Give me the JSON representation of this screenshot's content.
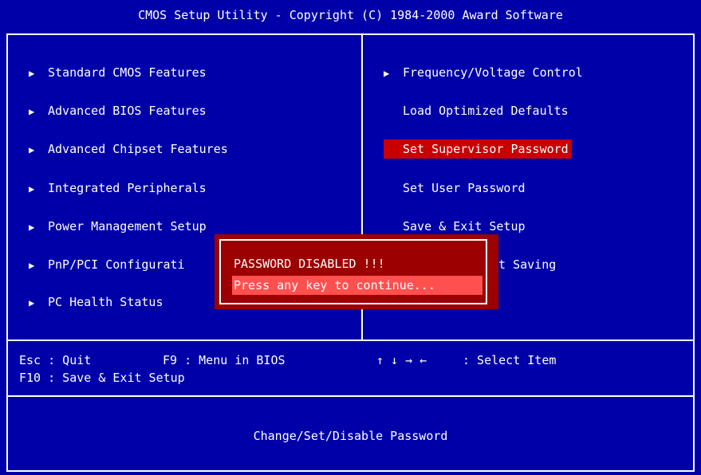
{
  "header": {
    "title": "CMOS Setup Utility - Copyright (C) 1984-2000 Award Software"
  },
  "colors": {
    "background": "#0000a8",
    "text": "#ffffff",
    "selected": "#c80000",
    "dialog": "#9c0000",
    "dialog_prompt": "#ff5050"
  },
  "icons": {
    "submenu": "triangle-right-icon"
  },
  "left_menu": [
    {
      "label": "Standard CMOS Features",
      "submenu": true
    },
    {
      "label": "Advanced BIOS Features",
      "submenu": true
    },
    {
      "label": "Advanced Chipset Features",
      "submenu": true
    },
    {
      "label": "Integrated Peripherals",
      "submenu": true
    },
    {
      "label": "Power Management Setup",
      "submenu": true
    },
    {
      "label": "PnP/PCI Configurati",
      "submenu": true
    },
    {
      "label": "PC Health Status",
      "submenu": true
    }
  ],
  "right_menu": [
    {
      "label": "Frequency/Voltage Control",
      "submenu": true
    },
    {
      "label": "Load Optimized Defaults",
      "submenu": false
    },
    {
      "label": "Set Supervisor Password",
      "submenu": false,
      "selected": true
    },
    {
      "label": "Set User Password",
      "submenu": false
    },
    {
      "label": "Save & Exit Setup",
      "submenu": false
    },
    {
      "label": "ut Saving",
      "submenu": false
    }
  ],
  "dialog": {
    "title": "PASSWORD DISABLED !!!",
    "prompt": "Press any key to continue..."
  },
  "help": {
    "esc": "Esc : Quit",
    "f9": "F9 : Menu in BIOS",
    "arrows": "↑ ↓ → ←",
    "select": ": Select Item",
    "f10": "F10 : Save & Exit Setup"
  },
  "description": "Change/Set/Disable Password"
}
